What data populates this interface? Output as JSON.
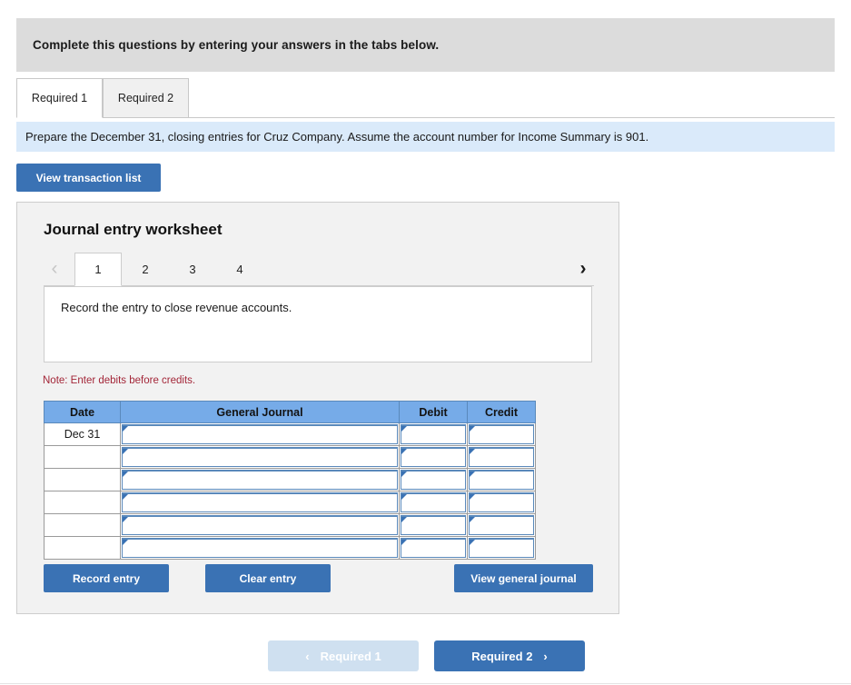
{
  "banner": {
    "text": "Complete this questions by entering your answers in the tabs below."
  },
  "requirement_tabs": {
    "items": [
      {
        "label": "Required 1",
        "active": true
      },
      {
        "label": "Required 2",
        "active": false
      }
    ]
  },
  "subinfo": {
    "text": "Prepare the December 31, closing entries for Cruz Company. Assume the account number for Income Summary is 901."
  },
  "toolbar": {
    "view_transaction_list_label": "View transaction list"
  },
  "worksheet": {
    "title": "Journal entry worksheet",
    "pager": {
      "prev_icon": "‹",
      "next_icon": "›",
      "pages": [
        {
          "label": "1",
          "active": true
        },
        {
          "label": "2",
          "active": false
        },
        {
          "label": "3",
          "active": false
        },
        {
          "label": "4",
          "active": false
        }
      ]
    },
    "prompt": "Record the entry to close revenue accounts.",
    "note": "Note: Enter debits before credits.",
    "table": {
      "columns": [
        "Date",
        "General Journal",
        "Debit",
        "Credit"
      ],
      "rows": [
        {
          "date": "Dec 31",
          "general_journal": "",
          "debit": "",
          "credit": ""
        },
        {
          "date": "",
          "general_journal": "",
          "debit": "",
          "credit": ""
        },
        {
          "date": "",
          "general_journal": "",
          "debit": "",
          "credit": ""
        },
        {
          "date": "",
          "general_journal": "",
          "debit": "",
          "credit": ""
        },
        {
          "date": "",
          "general_journal": "",
          "debit": "",
          "credit": ""
        },
        {
          "date": "",
          "general_journal": "",
          "debit": "",
          "credit": ""
        }
      ]
    },
    "actions": {
      "record_label": "Record entry",
      "clear_label": "Clear entry",
      "view_journal_label": "View general journal"
    }
  },
  "bottom_nav": {
    "prev_label": "Required 1",
    "next_label": "Required 2",
    "prev_icon": "‹",
    "next_icon": "›",
    "prev_disabled": true
  },
  "colors": {
    "accent_blue": "#3a72b4",
    "table_header_blue": "#76abe8",
    "banner_gray": "#dcdcdc",
    "subinfo_blue": "#daeafa",
    "panel_gray": "#f2f2f2",
    "note_red": "#a32638",
    "disabled_blue": "#cfe0f0"
  }
}
